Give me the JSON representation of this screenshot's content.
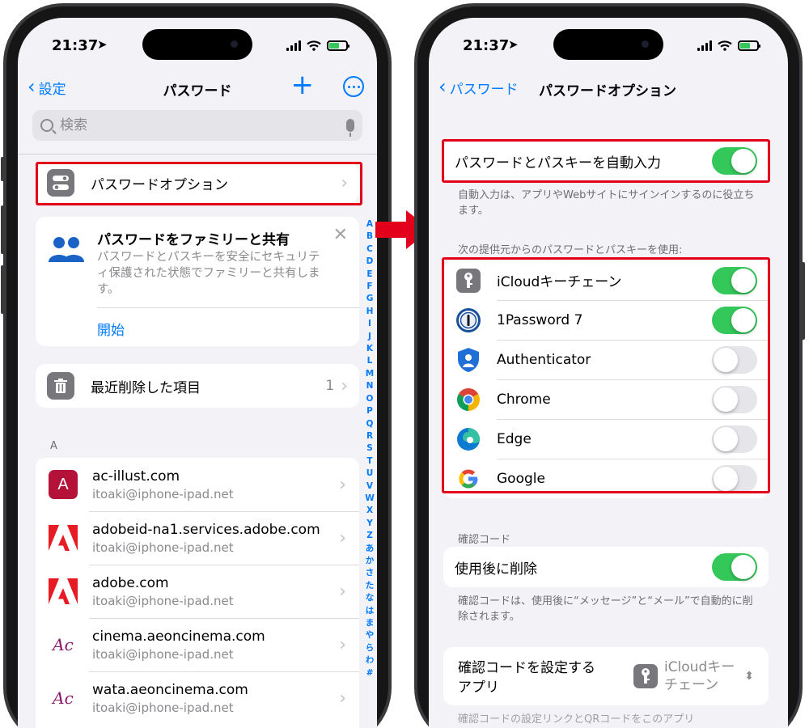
{
  "status": {
    "time": "21:37"
  },
  "left": {
    "nav": {
      "back_label": "設定",
      "title": "パスワード"
    },
    "search": {
      "placeholder": "検索"
    },
    "options_row": {
      "label": "パスワードオプション"
    },
    "share_card": {
      "title": "パスワードをファミリーと共有",
      "description": "パスワードとパスキーを安全にセキュリティ保護された状態でファミリーと共有します。",
      "start_label": "開始"
    },
    "deleted_row": {
      "label": "最近削除した項目",
      "count": "1"
    },
    "section_letter": "A",
    "accounts": [
      {
        "site": "ac-illust.com",
        "user": "itoaki@iphone-ipad.net",
        "icon": "ac-illust-logo",
        "letter": "A",
        "color": "#b5123a"
      },
      {
        "site": "adobeid-na1.services.adobe.com",
        "user": "itoaki@iphone-ipad.net",
        "icon": "adobe-logo",
        "color": "#e61b23"
      },
      {
        "site": "adobe.com",
        "user": "itoaki@iphone-ipad.net",
        "icon": "adobe-logo",
        "color": "#e61b23"
      },
      {
        "site": "cinema.aeoncinema.com",
        "user": "itoaki@iphone-ipad.net",
        "icon": "aeon-cinema-logo",
        "letter": "Ac",
        "color": "#8b1a6b"
      },
      {
        "site": "wata.aeoncinema.com",
        "user": "itoaki@iphone-ipad.net",
        "icon": "aeon-cinema-logo",
        "letter": "Ac",
        "color": "#8b1a6b"
      }
    ],
    "index_letters": [
      "A",
      "B",
      "C",
      "D",
      "E",
      "F",
      "G",
      "H",
      "I",
      "J",
      "K",
      "L",
      "M",
      "N",
      "O",
      "P",
      "Q",
      "R",
      "S",
      "T",
      "U",
      "V",
      "W",
      "X",
      "Y",
      "Z",
      "あ",
      "か",
      "さ",
      "た",
      "な",
      "は",
      "ま",
      "や",
      "ら",
      "わ",
      "#"
    ]
  },
  "right": {
    "nav": {
      "back_label": "パスワード",
      "title": "パスワードオプション"
    },
    "autofill": {
      "label": "パスワードとパスキーを自動入力",
      "on": true
    },
    "autofill_note": "自動入力は、アプリやWebサイトにサインインするのに役立ちます。",
    "providers_header": "次の提供元からのパスワードとパスキーを使用:",
    "providers": [
      {
        "name": "iCloudキーチェーン",
        "icon": "key-icon",
        "on": true
      },
      {
        "name": "1Password 7",
        "icon": "1password-icon",
        "on": true
      },
      {
        "name": "Authenticator",
        "icon": "authenticator-icon",
        "on": false
      },
      {
        "name": "Chrome",
        "icon": "chrome-icon",
        "on": false
      },
      {
        "name": "Edge",
        "icon": "edge-icon",
        "on": false
      },
      {
        "name": "Google",
        "icon": "google-icon",
        "on": false
      }
    ],
    "code_header": "確認コード",
    "delete_after_use": {
      "label": "使用後に削除",
      "on": true
    },
    "code_note": "確認コードは、使用後に“メッセージ”と“メール”で自動的に削除されます。",
    "code_app": {
      "label_line1": "確認コードを設定する",
      "label_line2": "アプリ",
      "value_line1": "iCloudキー",
      "value_line2": "チェーン"
    },
    "bottom_note": "確認コードの設定リンクとQRコードをこのアプリ"
  },
  "colors": {
    "accent": "#007aff",
    "toggle_on": "#34c759",
    "highlight": "#e2001a"
  }
}
